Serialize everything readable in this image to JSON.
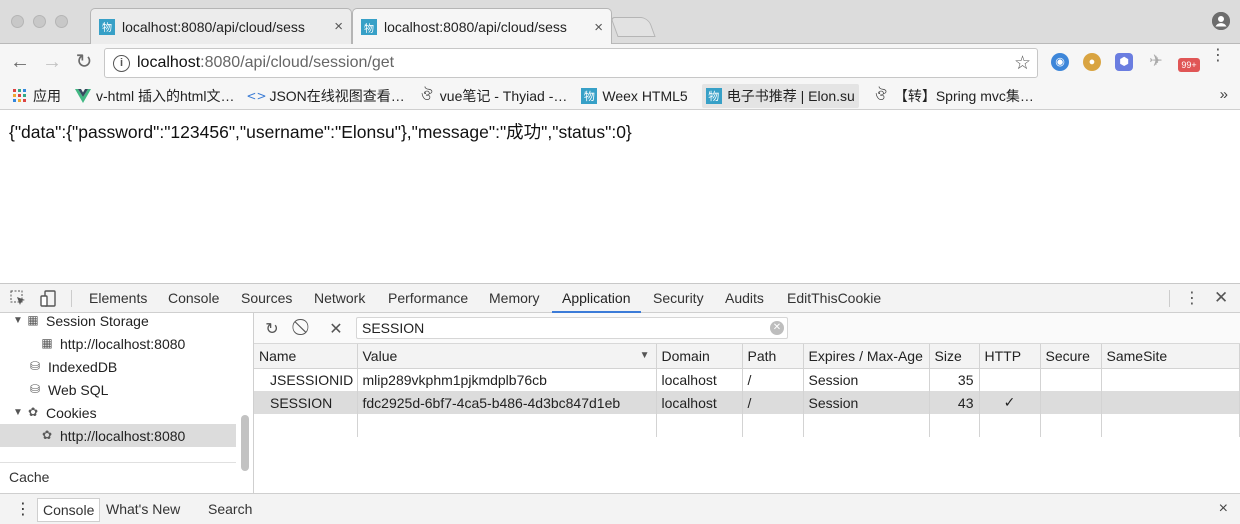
{
  "browser": {
    "tabs": [
      {
        "title": "localhost:8080/api/cloud/sess",
        "favicon": "物",
        "close": "×"
      },
      {
        "title": "localhost:8080/api/cloud/sess",
        "favicon": "物",
        "close": "×"
      }
    ],
    "address": {
      "host": "localhost",
      "path": ":8080/api/cloud/session/get"
    },
    "extensions": {
      "badge": "99+"
    },
    "bookmarks": [
      {
        "label": "应用",
        "icon": "apps-grid-icon"
      },
      {
        "label": "v-html 插入的html文…",
        "icon": "vue-icon"
      },
      {
        "label": "JSON在线视图查看…",
        "icon": "code-icon"
      },
      {
        "label": "vue笔记 - Thyiad -…",
        "icon": "swirl-icon"
      },
      {
        "label": "Weex HTML5",
        "icon": "物"
      },
      {
        "label": "电子书推荐 | Elon.su",
        "icon": "物"
      },
      {
        "label": "【转】Spring mvc集…",
        "icon": "swirl-icon"
      }
    ],
    "overflow": "»"
  },
  "page": {
    "body_text": "{\"data\":{\"password\":\"123456\",\"username\":\"Elonsu\"},\"message\":\"成功\",\"status\":0}"
  },
  "devtools": {
    "tabs": [
      "Elements",
      "Console",
      "Sources",
      "Network",
      "Performance",
      "Memory",
      "Application",
      "Security",
      "Audits",
      "EditThisCookie"
    ],
    "active_tab": "Application",
    "sidebar": {
      "session_storage": "Session Storage",
      "session_storage_origin": "http://localhost:8080",
      "indexeddb": "IndexedDB",
      "websql": "Web SQL",
      "cookies": "Cookies",
      "cookies_origin": "http://localhost:8080",
      "cache": "Cache"
    },
    "filter": {
      "value": "SESSION"
    },
    "cookie_table": {
      "headers": [
        "Name",
        "Value",
        "Domain",
        "Path",
        "Expires / Max-Age",
        "Size",
        "HTTP",
        "Secure",
        "SameSite"
      ],
      "rows": [
        {
          "name": "JSESSIONID",
          "value": "mlip289vkphm1pjkmdplb76cb",
          "domain": "localhost",
          "path": "/",
          "expires": "Session",
          "size": "35",
          "http": "",
          "secure": "",
          "samesite": ""
        },
        {
          "name": "SESSION",
          "value": "fdc2925d-6bf7-4ca5-b486-4d3bc847d1eb",
          "domain": "localhost",
          "path": "/",
          "expires": "Session",
          "size": "43",
          "http": "✓",
          "secure": "",
          "samesite": ""
        }
      ]
    },
    "drawer": {
      "tabs": [
        "Console",
        "What's New",
        "Search"
      ],
      "close": "×"
    }
  },
  "colors": {
    "accent": "#3b7bd8",
    "favicon": "#37a0c7",
    "selected_row": "#dcdcdc"
  }
}
